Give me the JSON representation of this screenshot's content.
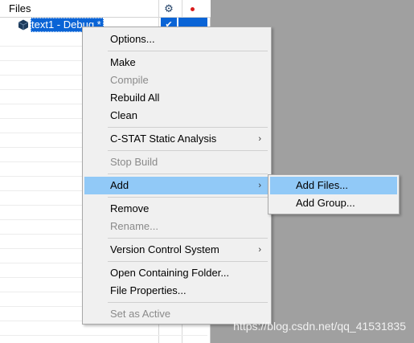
{
  "workspace": {
    "title": "Files",
    "header_icons": [
      "gear-icon",
      "red-dot-icon"
    ],
    "tree": {
      "item_label": "text1 - Debug *",
      "check_glyph": "✔",
      "icon": "project-cube-icon"
    }
  },
  "context_menu": {
    "items": [
      {
        "label": "Options...",
        "enabled": true
      },
      {
        "label": "Make",
        "enabled": true
      },
      {
        "label": "Compile",
        "enabled": false
      },
      {
        "label": "Rebuild All",
        "enabled": true
      },
      {
        "label": "Clean",
        "enabled": true
      },
      {
        "label": "C-STAT Static Analysis",
        "enabled": true,
        "submenu": true
      },
      {
        "label": "Stop Build",
        "enabled": false
      },
      {
        "label": "Add",
        "enabled": true,
        "submenu": true,
        "highlighted": true
      },
      {
        "label": "Remove",
        "enabled": true
      },
      {
        "label": "Rename...",
        "enabled": false
      },
      {
        "label": "Version Control System",
        "enabled": true,
        "submenu": true
      },
      {
        "label": "Open Containing Folder...",
        "enabled": true
      },
      {
        "label": "File Properties...",
        "enabled": true
      },
      {
        "label": "Set as Active",
        "enabled": false
      }
    ],
    "submenu_arrow": "›"
  },
  "add_submenu": {
    "items": [
      {
        "label": "Add Files...",
        "highlighted": true
      },
      {
        "label": "Add Group..."
      }
    ]
  },
  "watermark": "https://blog.csdn.net/qq_41531835",
  "colors": {
    "selection": "#0a64d6",
    "menu_highlight": "#91c9f7",
    "menu_bg": "#f0f0f0",
    "background": "#a0a0a0"
  }
}
